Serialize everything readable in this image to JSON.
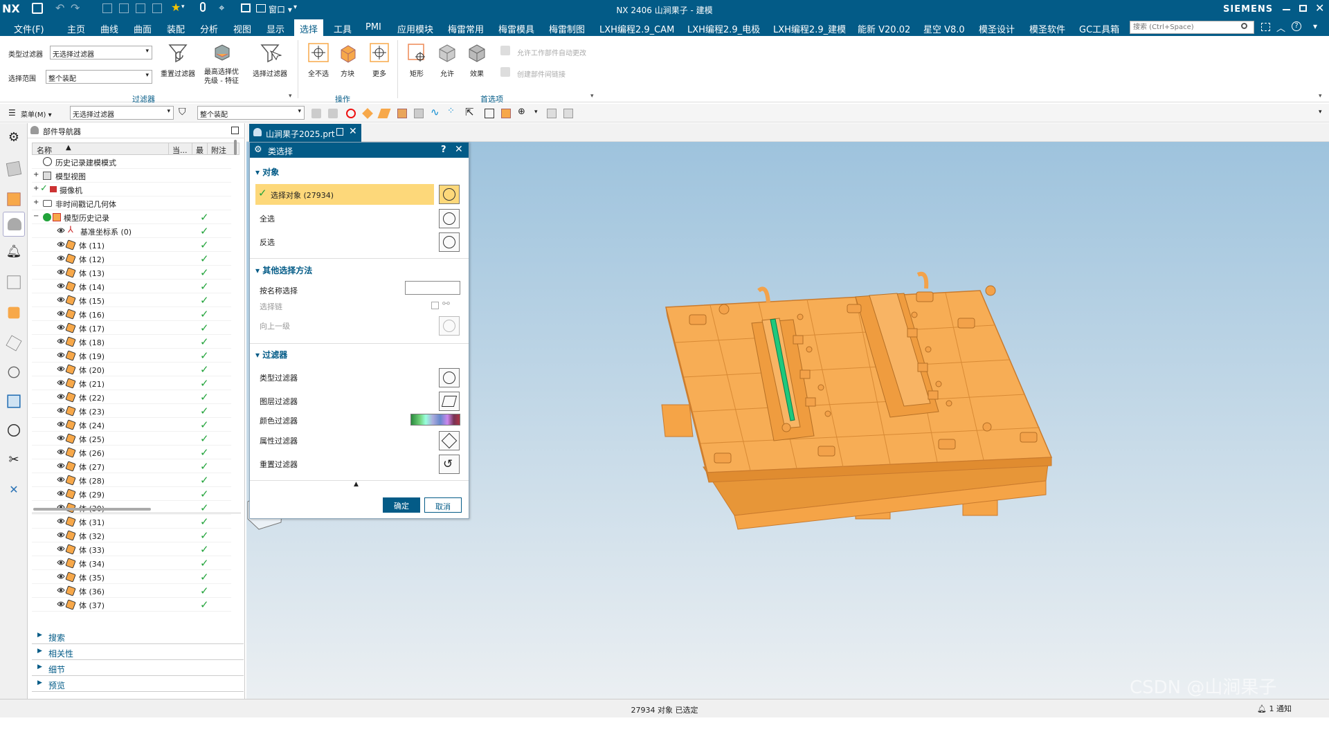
{
  "window": {
    "title": "NX 2406 山涧果子 - 建模",
    "logo": "NX",
    "brand": "SIEMENS"
  },
  "menu": {
    "items": [
      "文件(F)",
      "主页",
      "曲线",
      "曲面",
      "装配",
      "分析",
      "视图",
      "显示",
      "选择",
      "工具",
      "PMI",
      "应用模块",
      "梅雷常用",
      "梅雷模具",
      "梅雷制图",
      "LXH编程2.9_CAM",
      "LXH编程2.9_电极",
      "LXH编程2.9_建模",
      "能新 V20.02",
      "星空 V8.0",
      "模圣设计",
      "模圣软件",
      "GC工具箱"
    ],
    "search_placeholder": "搜索 (Ctrl+Space)",
    "window_menu": "窗口"
  },
  "ribbon": {
    "type_filter_label": "类型过滤器",
    "type_filter_value": "无选择过滤器",
    "scope_label": "选择范围",
    "scope_value": "整个装配",
    "reset_filter": "重置过滤器",
    "highest_priority": "最高选择优\n先级 - 特征",
    "select_filter": "选择过滤器",
    "group_filter": "过滤器",
    "deselect_all": "全不选",
    "block": "方块",
    "more": "更多",
    "group_ops": "操作",
    "rect": "矩形",
    "allow": "允许",
    "effect": "效果",
    "allow_work_part": "允许工作部件自动更改",
    "create_interpart_link": "创建部件间链接",
    "group_prefs": "首选项"
  },
  "selbar": {
    "menu": "菜单(M)",
    "filter": "无选择过滤器",
    "scope": "整个装配"
  },
  "nav": {
    "title": "部件导航器",
    "columns": [
      "名称",
      "当...",
      "最",
      "附注"
    ],
    "top_rows": [
      "历史记录建模模式",
      "模型视图",
      "摄像机",
      "非时间戳记几何体",
      "模型历史记录",
      "基准坐标系 (0)"
    ],
    "bodies": [
      "体 (11)",
      "体 (12)",
      "体 (13)",
      "体 (14)",
      "体 (15)",
      "体 (16)",
      "体 (17)",
      "体 (18)",
      "体 (19)",
      "体 (20)",
      "体 (21)",
      "体 (22)",
      "体 (23)",
      "体 (24)",
      "体 (25)",
      "体 (26)",
      "体 (27)",
      "体 (28)",
      "体 (29)",
      "体 (30)",
      "体 (31)",
      "体 (32)",
      "体 (33)",
      "体 (34)",
      "体 (35)",
      "体 (36)",
      "体 (37)"
    ],
    "sections": [
      "搜索",
      "相关性",
      "细节",
      "预览"
    ]
  },
  "file_tab": "山涧果子2025.prt",
  "dialog": {
    "title": "类选择",
    "sec_object": "对象",
    "select_object": "选择对象 (27934)",
    "select_all": "全选",
    "invert": "反选",
    "sec_other": "其他选择方法",
    "by_name": "按名称选择",
    "select_chain": "选择链",
    "up_level": "向上一级",
    "sec_filter": "过滤器",
    "type_filter": "类型过滤器",
    "layer_filter": "图层过滤器",
    "color_filter": "颜色过滤器",
    "attr_filter": "属性过滤器",
    "reset_filter": "重置过滤器",
    "ok": "确定",
    "cancel": "取消"
  },
  "status": {
    "text": "27934 对象 已选定",
    "notify": "1 通知"
  },
  "watermark": "CSDN @山涧果子",
  "colors": {
    "accent": "#035b87",
    "model": "#f7a84a",
    "check": "#21a33a"
  }
}
